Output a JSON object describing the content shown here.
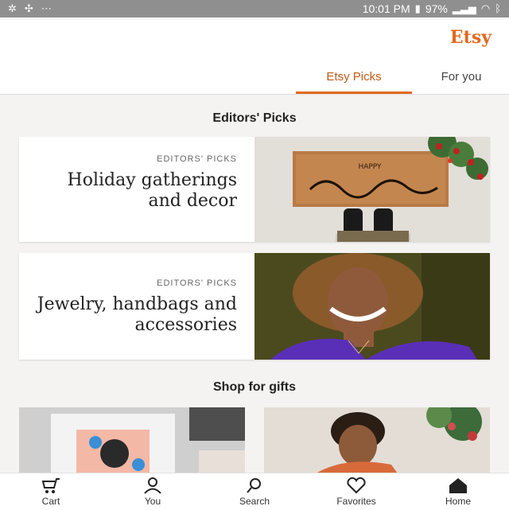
{
  "status_bar": {
    "time": "10:01 PM",
    "battery": "97%",
    "icons": [
      "battery-icon",
      "signal-icon",
      "wifi-icon",
      "bluetooth-icon",
      "more-icon",
      "settings-icon",
      "fan-icon"
    ]
  },
  "header": {
    "brand": "Etsy",
    "tabs": [
      {
        "label": "For you",
        "active": false
      },
      {
        "label": "Etsy Picks",
        "active": true
      }
    ]
  },
  "sections": {
    "editors_picks_title": "Editors' Picks",
    "shop_for_gifts_title": "Shop for gifts"
  },
  "cards": [
    {
      "eyebrow": "EDITORS' PICKS",
      "title": "Holiday gatherings and decor",
      "image": "holiday-doormat-image"
    },
    {
      "eyebrow": "EDITORS' PICKS",
      "title": "Jewelry, handbags and accessories",
      "image": "woman-portrait-image"
    }
  ],
  "bottom_nav": [
    {
      "label": "Home",
      "icon": "home-icon",
      "active": true
    },
    {
      "label": "Favorites",
      "icon": "heart-icon",
      "active": false
    },
    {
      "label": "Search",
      "icon": "search-icon",
      "active": false
    },
    {
      "label": "You",
      "icon": "person-icon",
      "active": false
    },
    {
      "label": "Cart",
      "icon": "cart-icon",
      "active": false
    }
  ],
  "colors": {
    "accent": "#e2691f",
    "status_bar": "#8f8f8f",
    "background": "#f4f3f1"
  }
}
